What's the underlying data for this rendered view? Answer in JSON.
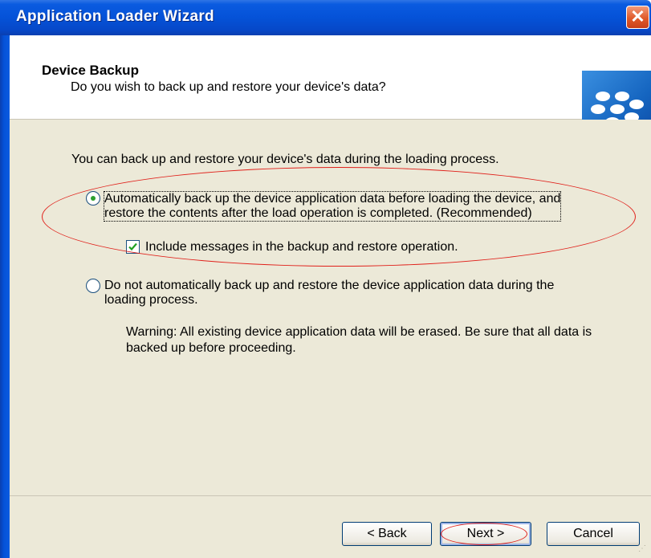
{
  "window": {
    "title": "Application Loader Wizard",
    "close_glyph": "✕"
  },
  "header": {
    "title": "Device Backup",
    "subtitle": "Do you wish to back up and restore your device's data?",
    "logo_icon": "blackberry-logo-icon"
  },
  "body": {
    "intro": "You can back up and restore your device's data during the loading process.",
    "option_auto": {
      "line1": "Automatically back up the device application data before loading the device, and",
      "line2": "restore the contents after the load operation is completed.  (Recommended)",
      "selected": true
    },
    "include_messages": {
      "label": "Include messages in the backup and restore operation.",
      "checked": true
    },
    "option_none": {
      "line1": "Do not automatically back up and restore the device application data during the",
      "line2": "loading process.",
      "selected": false
    },
    "warning": "Warning: All existing device application data will be erased. Be sure that all data is backed up before proceeding."
  },
  "buttons": {
    "back": "< Back",
    "next": "Next >",
    "cancel": "Cancel"
  },
  "colors": {
    "titlebar": "#0552d8",
    "close": "#e05a2a",
    "annotation": "#e0201a",
    "panel": "#ece9d8"
  }
}
